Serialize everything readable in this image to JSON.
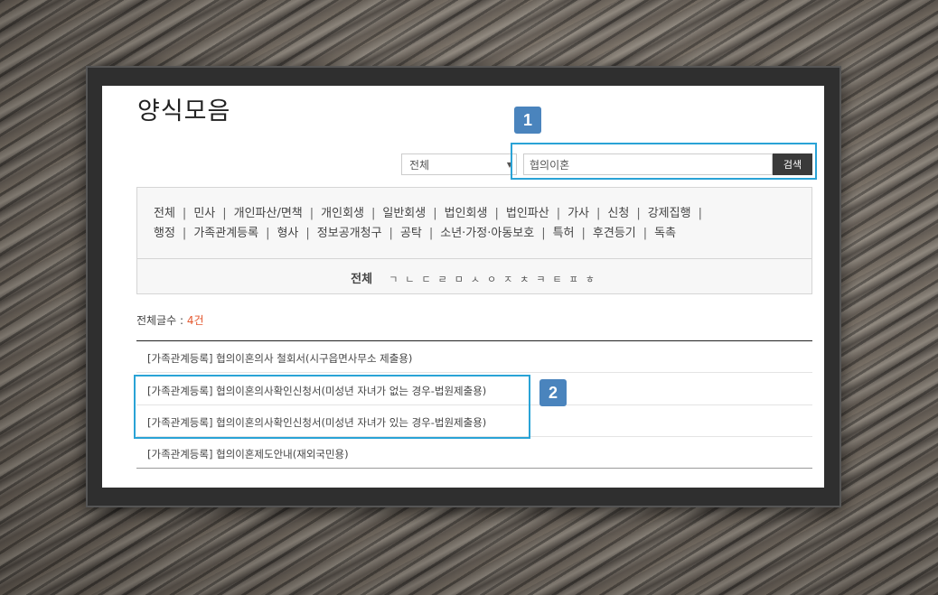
{
  "page": {
    "title": "양식모음"
  },
  "annotations": {
    "badge1": "1",
    "badge2": "2"
  },
  "search": {
    "scope_value": "전체",
    "query_value": "협의이혼",
    "button_label": "검색"
  },
  "categories": {
    "row1": [
      "전체",
      "민사",
      "개인파산/면책",
      "개인회생",
      "일반회생",
      "법인회생",
      "법인파산",
      "가사",
      "신청",
      "강제집행"
    ],
    "row2": [
      "행정",
      "가족관계등록",
      "형사",
      "정보공개청구",
      "공탁",
      "소년·가정·아동보호",
      "특허",
      "후견등기",
      "독촉"
    ]
  },
  "consonants": {
    "all_label": "전체",
    "items": [
      "ㄱ",
      "ㄴ",
      "ㄷ",
      "ㄹ",
      "ㅁ",
      "ㅅ",
      "ㅇ",
      "ㅈ",
      "ㅊ",
      "ㅋ",
      "ㅌ",
      "ㅍ",
      "ㅎ"
    ]
  },
  "results": {
    "count_label": "전체글수 : ",
    "count_value": "4건",
    "items": [
      "[가족관계등록] 협의이혼의사 철회서(시구읍면사무소 제출용)",
      "[가족관계등록] 협의이혼의사확인신청서(미성년 자녀가 없는 경우-법원제출용)",
      "[가족관계등록] 협의이혼의사확인신청서(미성년 자녀가 있는 경우-법원제출용)",
      "[가족관계등록] 협의이혼제도안내(재외국민용)"
    ]
  },
  "colors": {
    "badge": "#4a84bd",
    "highlight": "#2aa3d6",
    "count_accent": "#e4572e",
    "button": "#3a3a3a"
  }
}
